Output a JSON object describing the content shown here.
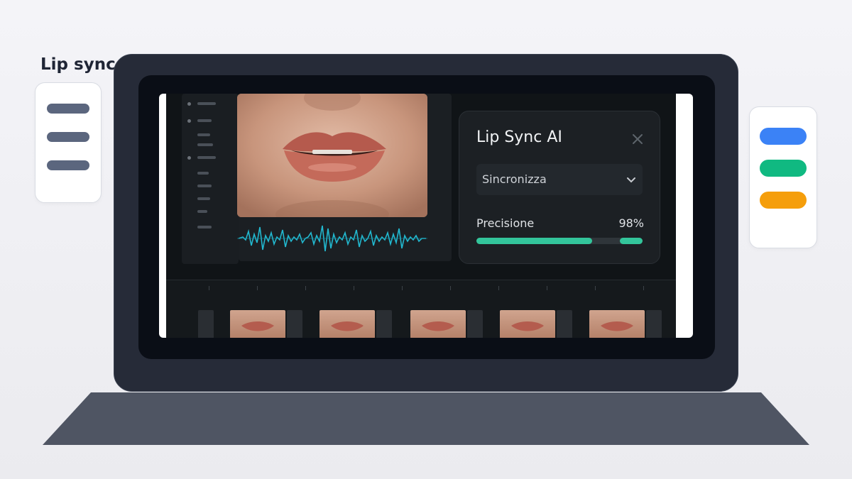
{
  "page": {
    "title": "Lip sync"
  },
  "left_card": {
    "lines": 3
  },
  "right_card": {
    "colors": [
      "#3b82f6",
      "#10b981",
      "#f59e0b"
    ]
  },
  "ai_panel": {
    "title": "Lip Sync AI",
    "select_value": "Sincronizza",
    "precision_label": "Precisione",
    "precision_value": "98%",
    "precision_fraction": 0.98
  },
  "colors": {
    "accent": "#33c59b",
    "waveform": "#22b8cf",
    "laptop": "#262b38",
    "laptop_base": "#4f5563"
  }
}
